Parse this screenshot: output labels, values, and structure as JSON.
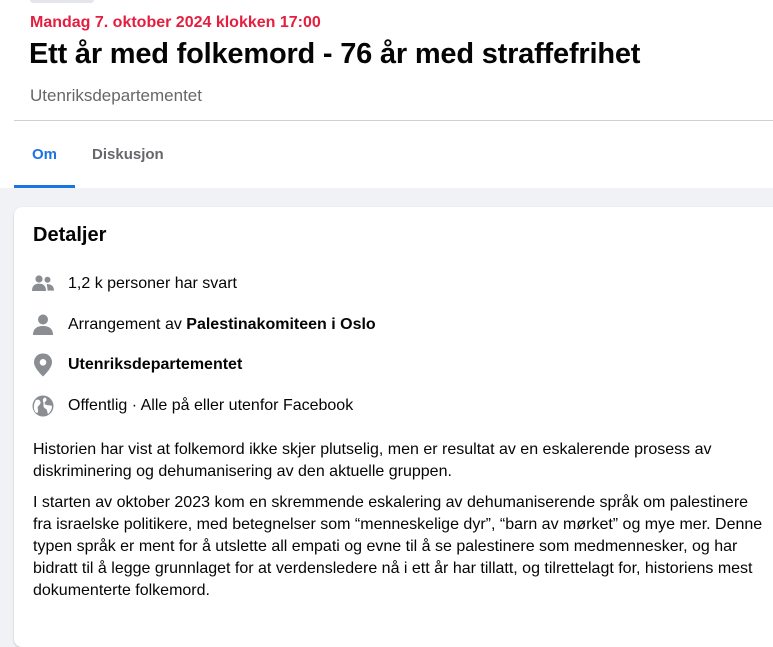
{
  "event": {
    "date": "Mandag 7. oktober 2024 klokken 17:00",
    "title": "Ett år med folkemord - 76 år med straffefrihet",
    "location": "Utenriksdepartementet"
  },
  "tabs": [
    {
      "label": "Om",
      "active": true
    },
    {
      "label": "Diskusjon",
      "active": false
    }
  ],
  "details": {
    "title": "Detaljer",
    "responses": {
      "icon": "people-icon",
      "text": "1,2 k personer har svart"
    },
    "organizer": {
      "icon": "person-icon",
      "prefix": "Arrangement av ",
      "name": "Palestinakomiteen i Oslo"
    },
    "place": {
      "icon": "location-pin-icon",
      "text": "Utenriksdepartementet"
    },
    "privacy": {
      "icon": "globe-icon",
      "text": "Offentlig · Alle på eller utenfor Facebook"
    }
  },
  "description": [
    "Historien har vist at folkemord ikke skjer plutselig, men er resultat av en eskalerende prosess av diskriminering og dehumanisering av den aktuelle gruppen.",
    "I starten av oktober 2023 kom en skremmende eskalering av dehumaniserende språk om palestinere fra israelske politikere, med betegnelser som “menneskelige dyr”, “barn av mørket” og mye mer. Denne typen språk er ment for å utslette all empati og evne til å se palestinere som medmennesker, og har bidratt til å legge grunnlaget for at verdensledere nå i ett år har tillatt, og tilrettelagt for, historiens mest dokumenterte folkemord."
  ],
  "colors": {
    "date_accent": "#e41e3f",
    "tab_active": "#1b74e4",
    "secondary_text": "#65676b",
    "icon_gray": "#8a8d91"
  }
}
